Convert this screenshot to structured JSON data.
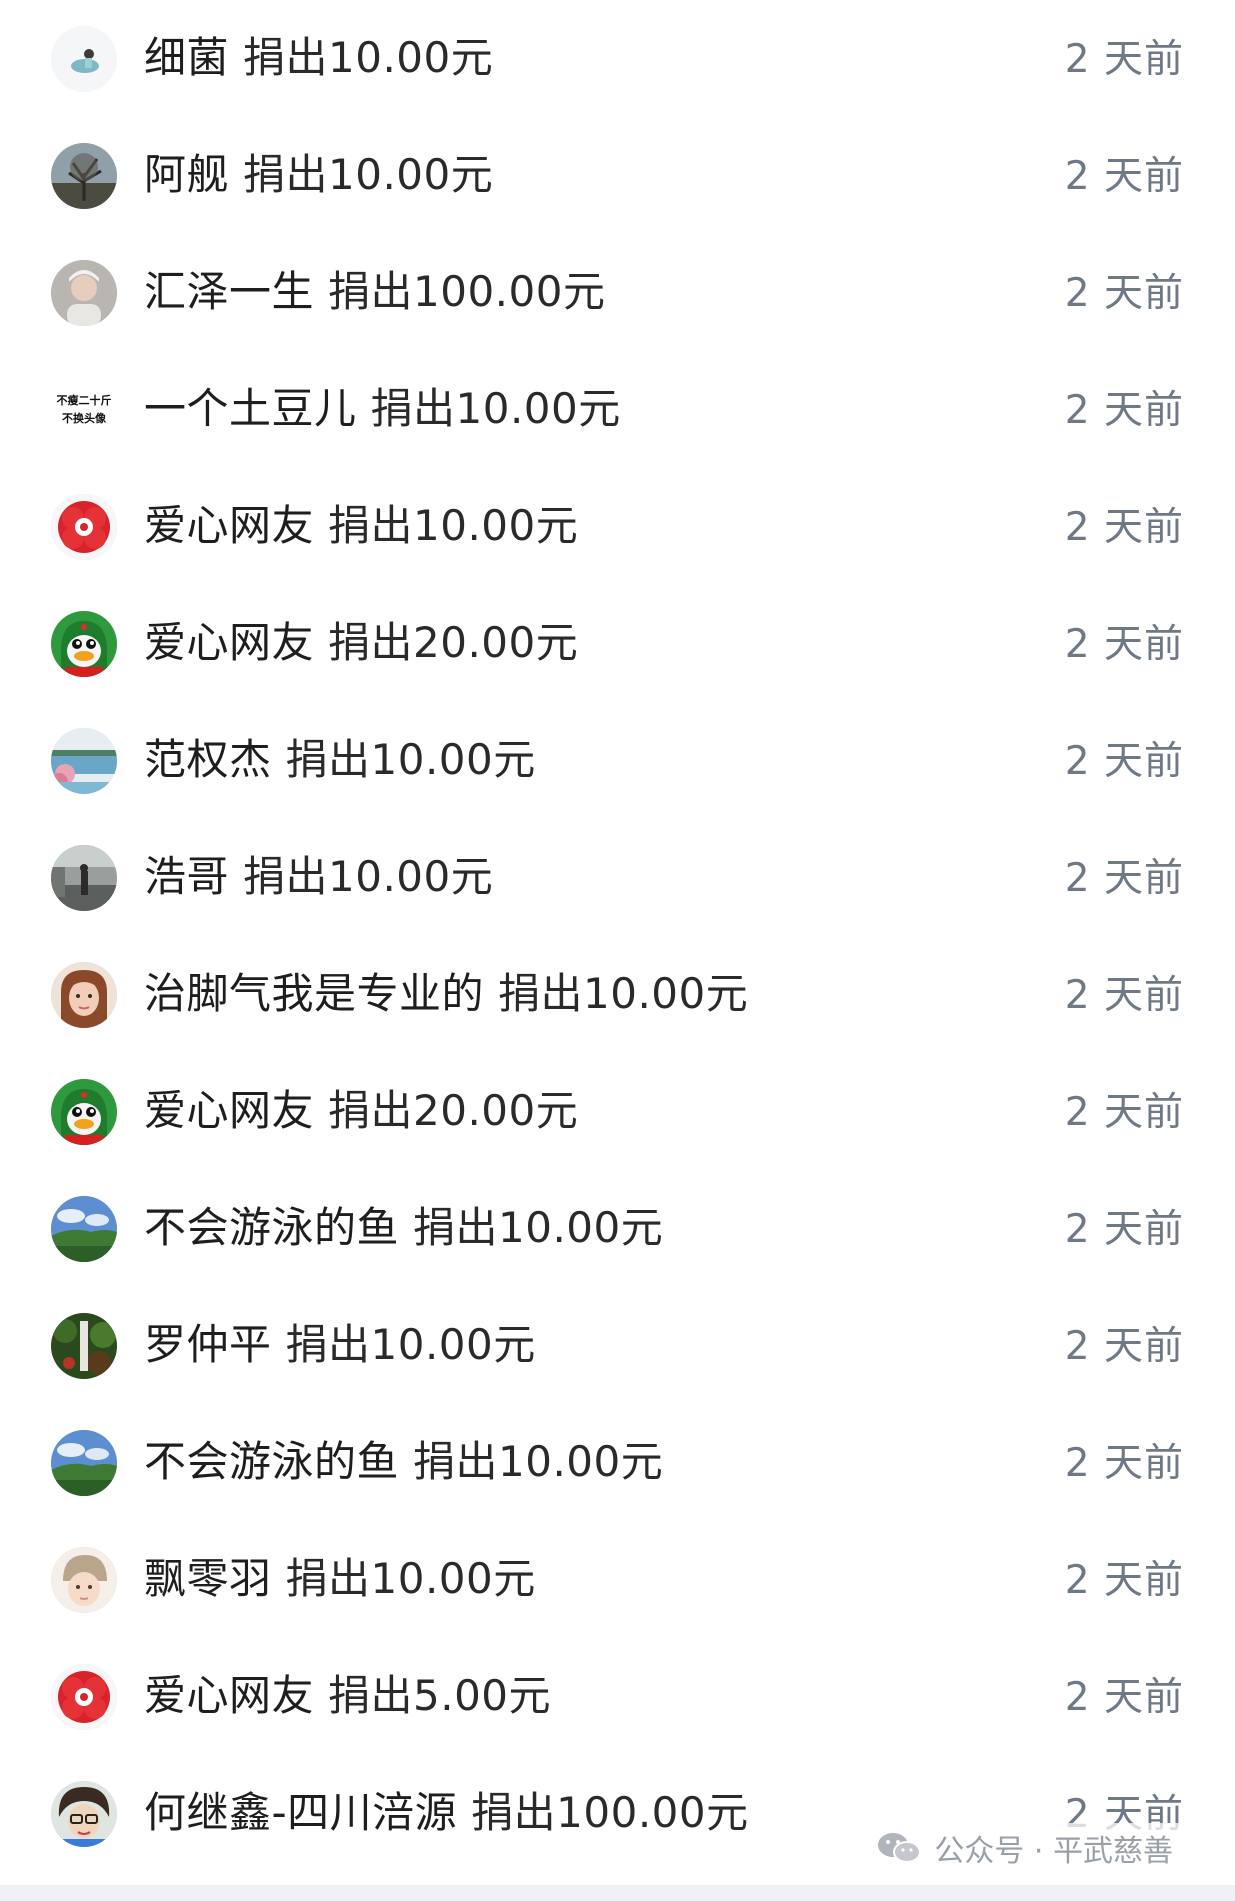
{
  "donations": [
    {
      "name": "细菌",
      "amount": "捐出10.00元",
      "time": "2 天前",
      "avatar": "person-avatar"
    },
    {
      "name": "阿舰",
      "amount": "捐出10.00元",
      "time": "2 天前",
      "avatar": "tree-avatar"
    },
    {
      "name": "汇泽一生",
      "amount": "捐出100.00元",
      "time": "2 天前",
      "avatar": "woman-avatar"
    },
    {
      "name": "一个土豆儿",
      "amount": "捐出10.00元",
      "time": "2 天前",
      "avatar": "text-avatar",
      "avatar_text": [
        "不瘦二十斤",
        "不换头像"
      ]
    },
    {
      "name": "爱心网友",
      "amount": "捐出10.00元",
      "time": "2 天前",
      "avatar": "red-flower-avatar"
    },
    {
      "name": "爱心网友",
      "amount": "捐出20.00元",
      "time": "2 天前",
      "avatar": "penguin-avatar"
    },
    {
      "name": "范权杰",
      "amount": "捐出10.00元",
      "time": "2 天前",
      "avatar": "lake-avatar"
    },
    {
      "name": "浩哥",
      "amount": "捐出10.00元",
      "time": "2 天前",
      "avatar": "street-avatar"
    },
    {
      "name": "治脚气我是专业的",
      "amount": "捐出10.00元",
      "time": "2 天前",
      "avatar": "girl-avatar"
    },
    {
      "name": "爱心网友",
      "amount": "捐出20.00元",
      "time": "2 天前",
      "avatar": "penguin-avatar"
    },
    {
      "name": "不会游泳的鱼",
      "amount": "捐出10.00元",
      "time": "2 天前",
      "avatar": "landscape-avatar"
    },
    {
      "name": "罗仲平",
      "amount": "捐出10.00元",
      "time": "2 天前",
      "avatar": "waterfall-avatar"
    },
    {
      "name": "不会游泳的鱼",
      "amount": "捐出10.00元",
      "time": "2 天前",
      "avatar": "landscape-avatar"
    },
    {
      "name": "飘零羽",
      "amount": "捐出10.00元",
      "time": "2 天前",
      "avatar": "child-avatar"
    },
    {
      "name": "爱心网友",
      "amount": "捐出5.00元",
      "time": "2 天前",
      "avatar": "red-flower-avatar"
    },
    {
      "name": "何继鑫-四川涪源",
      "amount": "捐出100.00元",
      "time": "2 天前",
      "avatar": "cartoon-avatar"
    }
  ],
  "watermark": {
    "text": "公众号 · 平武慈善",
    "icon": "wechat-icon"
  }
}
